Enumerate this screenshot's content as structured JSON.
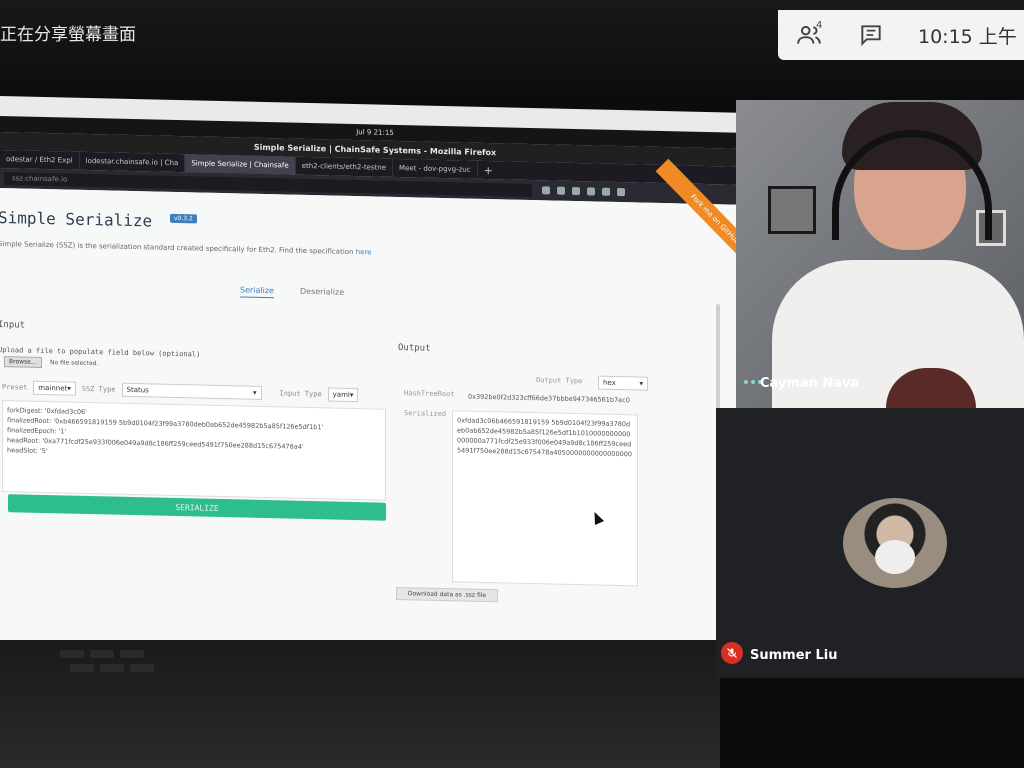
{
  "meet": {
    "share_banner": "正在分享螢幕畫面",
    "participant_count": "4",
    "time": "10:15 上午",
    "participants": [
      {
        "name": "Cayman Nava"
      },
      {
        "name": "Summer Liu"
      }
    ]
  },
  "os": {
    "clock": "Jul 9  21:15"
  },
  "firefox": {
    "window_title": "Simple Serialize | ChainSafe Systems - Mozilla Firefox",
    "tabs": [
      {
        "label": "odestar / Eth2 Expl",
        "active": false
      },
      {
        "label": "lodestar.chainsafe.io | Cha",
        "active": false
      },
      {
        "label": "Simple Serialize | Chainsafe",
        "active": true
      },
      {
        "label": "eth2-clients/eth2-testne",
        "active": false
      },
      {
        "label": "Meet - dov-pgvg-zuc",
        "active": false
      }
    ],
    "new_tab": "+",
    "url": "ssz.chainsafe.io"
  },
  "page": {
    "title": "Simple Serialize",
    "version": "v0.3.2",
    "intro": "Simple Serialize (SSZ) is the serialization standard created specifically for Eth2. Find the specification",
    "intro_link": "here",
    "ribbon": "Fork me on GitHub",
    "tabs": [
      "Serialize",
      "Deserialize"
    ],
    "input_heading": "Input",
    "upload_label": "Upload a file to populate field below (optional)",
    "browse_label": "Browse...",
    "no_file_label": "No file selected.",
    "preset_label": "Preset",
    "preset_value": "mainnet",
    "ssz_type_label": "SSZ Type",
    "ssz_type_value": "Status",
    "input_type_label": "Input Type",
    "input_type_value": "yaml",
    "input_lines": [
      "forkDigest: '0xfdad3c06'",
      "finalizedRoot: '0xb466591819159 5b9d0104f23f99a3780deb0ab652de45982b5a85f126e5df1b1'",
      "finalizedEpoch: '1'",
      "headRoot: '0xa771fcdf25e933f006e049a9d8c186ff259ceed5491f750ee288d15c675478a4'",
      "headSlot: '5'"
    ],
    "serialize_button": "SERIALIZE",
    "output_heading": "Output",
    "output_type_label": "Output Type",
    "output_type_value": "hex",
    "hash_tree_root_label": "HashTreeRoot",
    "hash_tree_root_value": "0x392be0f2d323cff66de37bbbe947346561b7ec0",
    "serialized_label": "Serialized",
    "serialized_value": "0xfdad3c06b466591819159 5b9d0104f23f99a3780deb0ab652de45982b5a85f126e5df1b1010000000000000000a771fcdf25e933f006e049a9d8c186ff259ceed5491f750ee288d15c675478a4050000000000000000",
    "download_button": "Download data as .ssz file"
  }
}
